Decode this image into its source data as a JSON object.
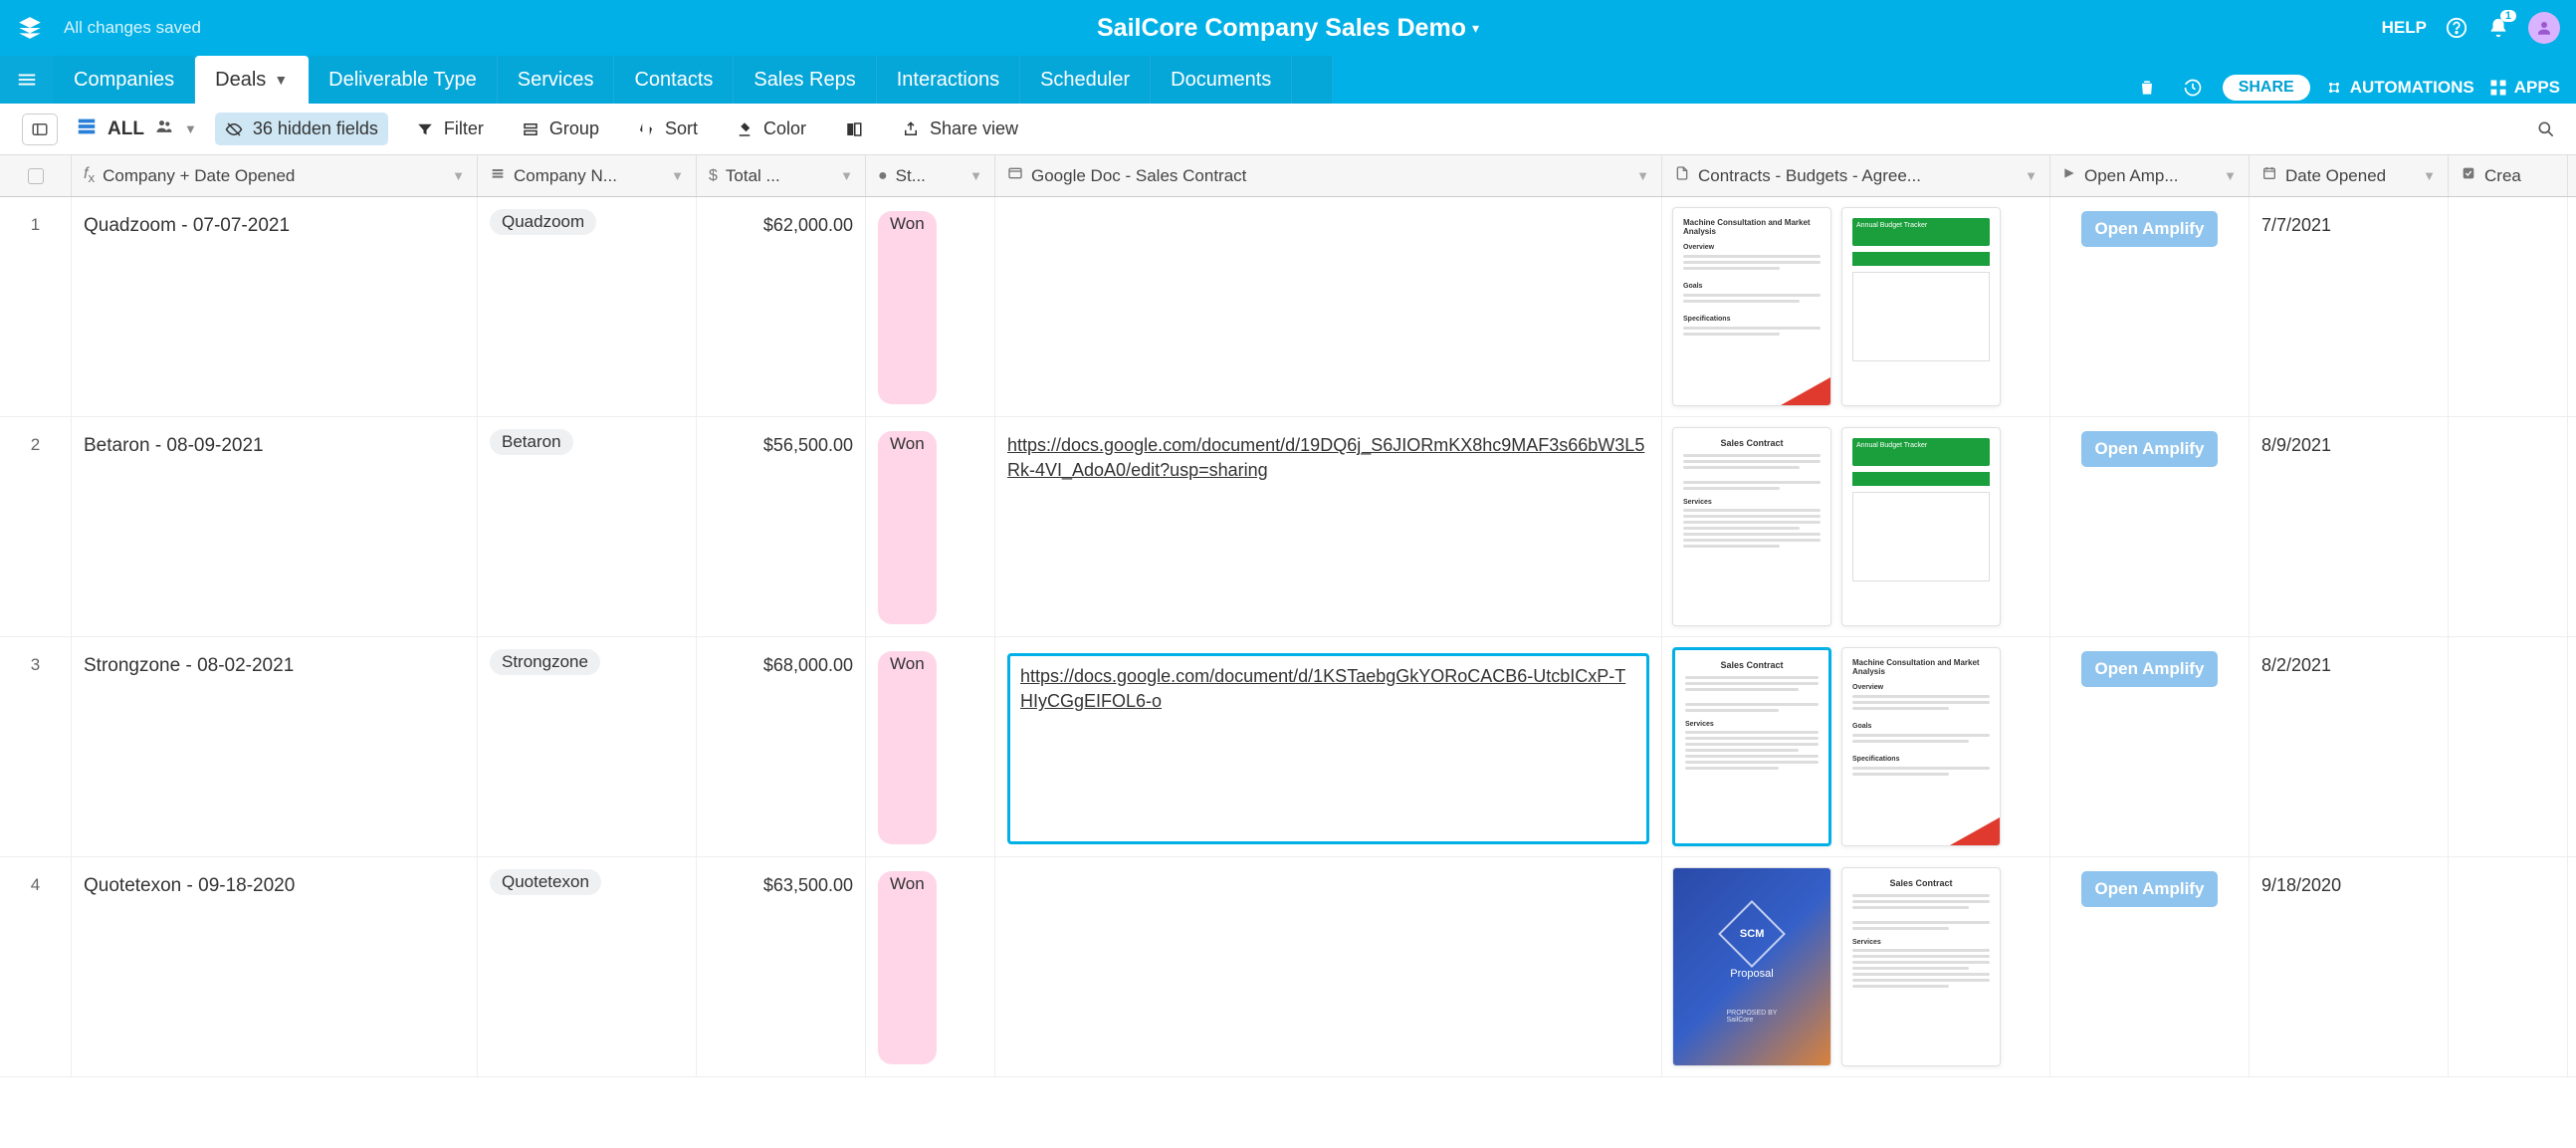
{
  "header": {
    "saved_text": "All changes saved",
    "title": "SailCore Company Sales Demo",
    "help_label": "HELP",
    "notification_count": "1"
  },
  "tabs": {
    "items": [
      {
        "label": "Companies"
      },
      {
        "label": "Deals"
      },
      {
        "label": "Deliverable Type"
      },
      {
        "label": "Services"
      },
      {
        "label": "Contacts"
      },
      {
        "label": "Sales Reps"
      },
      {
        "label": "Interactions"
      },
      {
        "label": "Scheduler"
      },
      {
        "label": "Documents"
      }
    ],
    "active_index": 1,
    "share_label": "SHARE",
    "automations_label": "AUTOMATIONS",
    "apps_label": "APPS"
  },
  "toolbar": {
    "view_name": "ALL",
    "hidden_fields_label": "36 hidden fields",
    "filter_label": "Filter",
    "group_label": "Group",
    "sort_label": "Sort",
    "color_label": "Color",
    "share_view_label": "Share view"
  },
  "columns": {
    "company_date": "Company + Date Opened",
    "company_name": "Company N...",
    "total": "Total ...",
    "status": "St...",
    "gdoc": "Google Doc - Sales Contract",
    "contracts": "Contracts - Budgets - Agree...",
    "amplify": "Open Amp...",
    "date_opened": "Date Opened",
    "created": "Crea"
  },
  "rows": [
    {
      "num": "1",
      "company_date": "Quadzoom - 07-07-2021",
      "company_name": "Quadzoom",
      "total": "$62,000.00",
      "status": "Won",
      "gdoc": "",
      "amplify": "Open Amplify",
      "date_opened": "7/7/2021",
      "thumb1_type": "doc_red",
      "thumb2_type": "budget_green",
      "thumb1_title": "Machine Consultation and Market Analysis",
      "thumb2_title": "Annual Budget Tracker"
    },
    {
      "num": "2",
      "company_date": "Betaron - 08-09-2021",
      "company_name": "Betaron",
      "total": "$56,500.00",
      "status": "Won",
      "gdoc": "https://docs.google.com/document/d/19DQ6j_S6JIORmKX8hc9MAF3s66bW3L5Rk-4VI_AdoA0/edit?usp=sharing",
      "amplify": "Open Amplify",
      "date_opened": "8/9/2021",
      "thumb1_type": "contract",
      "thumb2_type": "budget_green",
      "thumb1_title": "Sales Contract",
      "thumb2_title": "Annual Budget Tracker"
    },
    {
      "num": "3",
      "company_date": "Strongzone - 08-02-2021",
      "company_name": "Strongzone",
      "total": "$68,000.00",
      "status": "Won",
      "gdoc": "https://docs.google.com/document/d/1KSTaebgGkYORoCACB6-UtcbICxP-THIyCGgEIFOL6-o",
      "gdoc_active": true,
      "amplify": "Open Amplify",
      "date_opened": "8/2/2021",
      "thumb1_type": "contract",
      "thumb1_active": true,
      "thumb2_type": "doc_red",
      "thumb1_title": "Sales Contract",
      "thumb2_title": "Machine Consultation and Market Analysis"
    },
    {
      "num": "4",
      "company_date": "Quotetexon - 09-18-2020",
      "company_name": "Quotetexon",
      "total": "$63,500.00",
      "status": "Won",
      "gdoc": "",
      "amplify": "Open Amplify",
      "date_opened": "9/18/2020",
      "thumb1_type": "scm",
      "thumb2_type": "contract",
      "thumb1_title": "SCM Proposal",
      "thumb2_title": "Sales Contract"
    }
  ]
}
